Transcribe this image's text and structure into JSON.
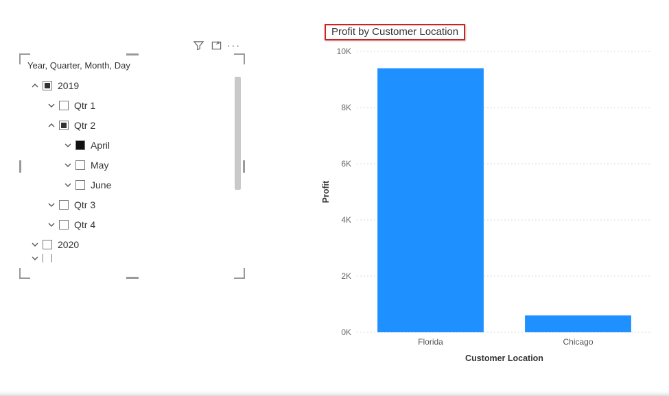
{
  "slicer": {
    "title": "Year, Quarter, Month, Day",
    "toolbar": {
      "filter_name": "filter-icon",
      "focus_name": "focus-mode-icon",
      "more_name": "more-options-icon"
    },
    "rows": [
      {
        "indent": 0,
        "arrow": "up",
        "check": "partial",
        "label": "2019"
      },
      {
        "indent": 1,
        "arrow": "down",
        "check": "empty",
        "label": "Qtr 1"
      },
      {
        "indent": 1,
        "arrow": "up",
        "check": "partial",
        "label": "Qtr 2"
      },
      {
        "indent": 2,
        "arrow": "down",
        "check": "checked",
        "label": "April"
      },
      {
        "indent": 2,
        "arrow": "down",
        "check": "empty",
        "label": "May"
      },
      {
        "indent": 2,
        "arrow": "down",
        "check": "empty",
        "label": "June"
      },
      {
        "indent": 1,
        "arrow": "down",
        "check": "empty",
        "label": "Qtr 3"
      },
      {
        "indent": 1,
        "arrow": "down",
        "check": "empty",
        "label": "Qtr 4"
      },
      {
        "indent": 0,
        "arrow": "down",
        "check": "empty",
        "label": "2020"
      }
    ],
    "extra_clipped_row": {
      "indent": 0,
      "arrow": "down",
      "check": "empty",
      "label": ""
    }
  },
  "chart_data": {
    "type": "bar",
    "title": "Profit by Customer Location",
    "xlabel": "Customer Location",
    "ylabel": "Profit",
    "categories": [
      "Florida",
      "Chicago"
    ],
    "values": [
      9400,
      600
    ],
    "ylim": [
      0,
      10000
    ],
    "yticks": [
      0,
      2000,
      4000,
      6000,
      8000,
      10000
    ],
    "ytick_labels": [
      "0K",
      "2K",
      "4K",
      "6K",
      "8K",
      "10K"
    ],
    "bar_color": "#1e90ff"
  }
}
